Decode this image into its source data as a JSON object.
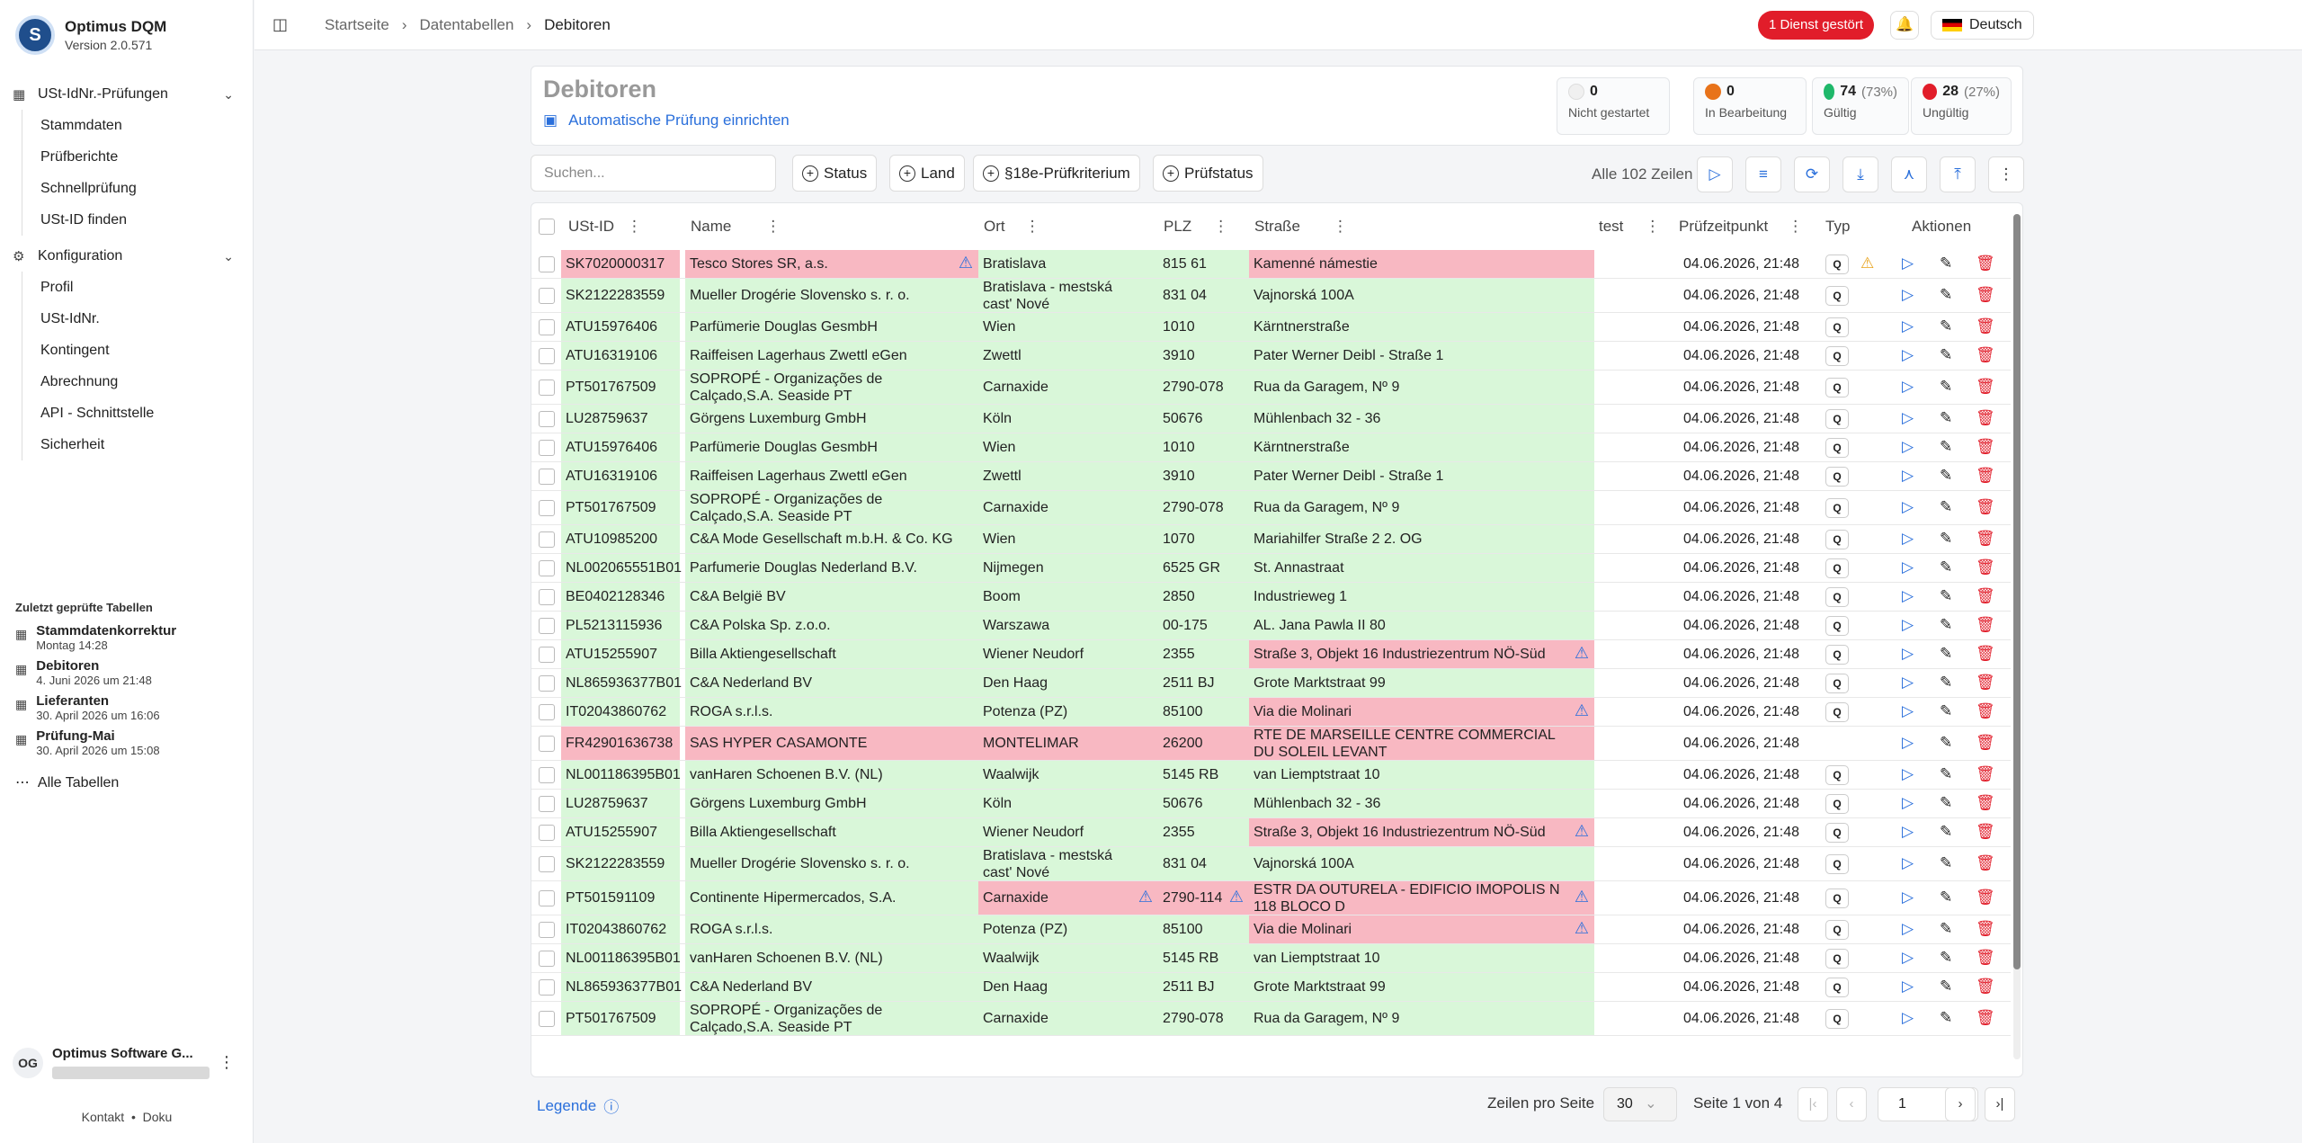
{
  "app": {
    "name": "Optimus DQM",
    "version": "Version 2.0.571",
    "logo_letter": "S"
  },
  "sidebar": {
    "group1": {
      "label": "USt-IdNr.-Prüfungen",
      "items": [
        "Stammdaten",
        "Prüfberichte",
        "Schnellprüfung",
        "USt-ID finden"
      ]
    },
    "group2": {
      "label": "Konfiguration",
      "items": [
        "Profil",
        "USt-IdNr.",
        "Kontingent",
        "Abrechnung",
        "API - Schnittstelle",
        "Sicherheit"
      ]
    },
    "recent_title": "Zuletzt geprüfte Tabellen",
    "recent": [
      {
        "name": "Stammdatenkorrektur",
        "date": "Montag 14:28"
      },
      {
        "name": "Debitoren",
        "date": "4. Juni 2026 um 21:48"
      },
      {
        "name": "Lieferanten",
        "date": "30. April 2026 um 16:06"
      },
      {
        "name": "Prüfung-Mai",
        "date": "30. April 2026 um 15:08"
      }
    ],
    "all_tables": "Alle Tabellen",
    "user": {
      "initials": "OG",
      "name": "Optimus Software G..."
    },
    "footer": {
      "contact": "Kontakt",
      "sep": "•",
      "docs": "Doku"
    }
  },
  "topbar": {
    "breadcrumb": [
      "Startseite",
      "Datentabellen",
      "Debitoren"
    ],
    "service_alert": "1 Dienst gestört",
    "language": "Deutsch"
  },
  "header": {
    "title": "Debitoren",
    "auto_check": "Automatische Prüfung einrichten",
    "stats": [
      {
        "value": "0",
        "pct": "",
        "label": "Nicht gestartet",
        "color": "#f0f0f0"
      },
      {
        "value": "0",
        "pct": "",
        "label": "In Bearbeitung",
        "color": "#e8731a"
      },
      {
        "value": "74",
        "pct": "(73%)",
        "label": "Gültig",
        "color": "#1fb86a"
      },
      {
        "value": "28",
        "pct": "(27%)",
        "label": "Ungültig",
        "color": "#e11d2a"
      }
    ]
  },
  "toolbar": {
    "search_placeholder": "Suchen...",
    "filters": [
      "Status",
      "Land",
      "§18e-Prüfkriterium",
      "Prüfstatus"
    ],
    "all_rows": "Alle 102 Zeilen"
  },
  "table": {
    "columns": [
      "USt-ID",
      "Name",
      "Ort",
      "PLZ",
      "Straße",
      "test",
      "Prüfzeitpunkt",
      "Typ",
      "Aktionen"
    ],
    "rows": [
      {
        "id": "SK7020000317",
        "name": "Tesco Stores SR, a.s.",
        "ort": "Bratislava",
        "plz": "815 61",
        "str": "Kamenné námestie",
        "time": "04.06.2026, 21:48",
        "q": "Q",
        "s": [
          "r",
          "r",
          "g",
          "g",
          "r"
        ],
        "w": [
          "name"
        ],
        "tw": true
      },
      {
        "id": "SK2122283559",
        "name": "Mueller Drogérie Slovensko s. r. o.",
        "ort": "Bratislava - mestská cast' Nové",
        "plz": "831 04",
        "str": "Vajnorská 100A",
        "time": "04.06.2026, 21:48",
        "q": "Q",
        "s": [
          "g",
          "g",
          "g",
          "g",
          "g"
        ],
        "w": []
      },
      {
        "id": "ATU15976406",
        "name": "Parfümerie Douglas GesmbH",
        "ort": "Wien",
        "plz": "1010",
        "str": "Kärntnerstraße",
        "time": "04.06.2026, 21:48",
        "q": "Q",
        "s": [
          "g",
          "g",
          "g",
          "g",
          "g"
        ],
        "w": []
      },
      {
        "id": "ATU16319106",
        "name": "Raiffeisen Lagerhaus Zwettl eGen",
        "ort": "Zwettl",
        "plz": "3910",
        "str": "Pater Werner Deibl - Straße 1",
        "time": "04.06.2026, 21:48",
        "q": "Q",
        "s": [
          "g",
          "g",
          "g",
          "g",
          "g"
        ],
        "w": []
      },
      {
        "id": "PT501767509",
        "name": "SOPROPÉ - Organizações de Calçado,S.A. Seaside PT",
        "ort": "Carnaxide",
        "plz": "2790-078",
        "str": "Rua da Garagem, Nº 9",
        "time": "04.06.2026, 21:48",
        "q": "Q",
        "s": [
          "g",
          "g",
          "g",
          "g",
          "g"
        ],
        "w": []
      },
      {
        "id": "LU28759637",
        "name": "Görgens Luxemburg GmbH",
        "ort": "Köln",
        "plz": "50676",
        "str": "Mühlenbach 32 - 36",
        "time": "04.06.2026, 21:48",
        "q": "Q",
        "s": [
          "g",
          "g",
          "g",
          "g",
          "g"
        ],
        "w": []
      },
      {
        "id": "ATU15976406",
        "name": "Parfümerie Douglas GesmbH",
        "ort": "Wien",
        "plz": "1010",
        "str": "Kärntnerstraße",
        "time": "04.06.2026, 21:48",
        "q": "Q",
        "s": [
          "g",
          "g",
          "g",
          "g",
          "g"
        ],
        "w": []
      },
      {
        "id": "ATU16319106",
        "name": "Raiffeisen Lagerhaus Zwettl eGen",
        "ort": "Zwettl",
        "plz": "3910",
        "str": "Pater Werner Deibl - Straße 1",
        "time": "04.06.2026, 21:48",
        "q": "Q",
        "s": [
          "g",
          "g",
          "g",
          "g",
          "g"
        ],
        "w": []
      },
      {
        "id": "PT501767509",
        "name": "SOPROPÉ - Organizações de Calçado,S.A. Seaside PT",
        "ort": "Carnaxide",
        "plz": "2790-078",
        "str": "Rua da Garagem, Nº 9",
        "time": "04.06.2026, 21:48",
        "q": "Q",
        "s": [
          "g",
          "g",
          "g",
          "g",
          "g"
        ],
        "w": []
      },
      {
        "id": "ATU10985200",
        "name": "C&A Mode Gesellschaft m.b.H. & Co. KG",
        "ort": "Wien",
        "plz": "1070",
        "str": "Mariahilfer Straße 2 2. OG",
        "time": "04.06.2026, 21:48",
        "q": "Q",
        "s": [
          "g",
          "g",
          "g",
          "g",
          "g"
        ],
        "w": []
      },
      {
        "id": "NL002065551B01",
        "name": "Parfumerie Douglas Nederland B.V.",
        "ort": "Nijmegen",
        "plz": "6525 GR",
        "str": "St. Annastraat",
        "time": "04.06.2026, 21:48",
        "q": "Q",
        "s": [
          "g",
          "g",
          "g",
          "g",
          "g"
        ],
        "w": []
      },
      {
        "id": "BE0402128346",
        "name": "C&A België BV",
        "ort": "Boom",
        "plz": "2850",
        "str": "Industrieweg 1",
        "time": "04.06.2026, 21:48",
        "q": "Q",
        "s": [
          "g",
          "g",
          "g",
          "g",
          "g"
        ],
        "w": []
      },
      {
        "id": "PL5213115936",
        "name": "C&A Polska Sp. z.o.o.",
        "ort": "Warszawa",
        "plz": "00-175",
        "str": "AL. Jana Pawla II 80",
        "time": "04.06.2026, 21:48",
        "q": "Q",
        "s": [
          "g",
          "g",
          "g",
          "g",
          "g"
        ],
        "w": []
      },
      {
        "id": "ATU15255907",
        "name": "Billa Aktiengesellschaft",
        "ort": "Wiener Neudorf",
        "plz": "2355",
        "str": "Straße 3, Objekt 16 Industriezentrum NÖ-Süd",
        "time": "04.06.2026, 21:48",
        "q": "Q",
        "s": [
          "g",
          "g",
          "g",
          "g",
          "r"
        ],
        "w": [
          "str"
        ]
      },
      {
        "id": "NL865936377B01",
        "name": "C&A Nederland BV",
        "ort": "Den Haag",
        "plz": "2511 BJ",
        "str": "Grote Marktstraat 99",
        "time": "04.06.2026, 21:48",
        "q": "Q",
        "s": [
          "g",
          "g",
          "g",
          "g",
          "g"
        ],
        "w": []
      },
      {
        "id": "IT02043860762",
        "name": "ROGA s.r.l.s.",
        "ort": "Potenza (PZ)",
        "plz": "85100",
        "str": "Via die Molinari",
        "time": "04.06.2026, 21:48",
        "q": "Q",
        "s": [
          "g",
          "g",
          "g",
          "g",
          "r"
        ],
        "w": [
          "str"
        ]
      },
      {
        "id": "FR42901636738",
        "name": "SAS HYPER CASAMONTE",
        "ort": "MONTELIMAR",
        "plz": "26200",
        "str": "RTE DE MARSEILLE CENTRE COMMERCIAL DU SOLEIL LEVANT",
        "time": "04.06.2026, 21:48",
        "q": "",
        "s": [
          "r",
          "r",
          "r",
          "r",
          "r"
        ],
        "w": []
      },
      {
        "id": "NL001186395B01",
        "name": "vanHaren Schoenen B.V. (NL)",
        "ort": "Waalwijk",
        "plz": "5145 RB",
        "str": "van Liemptstraat 10",
        "time": "04.06.2026, 21:48",
        "q": "Q",
        "s": [
          "g",
          "g",
          "g",
          "g",
          "g"
        ],
        "w": []
      },
      {
        "id": "LU28759637",
        "name": "Görgens Luxemburg GmbH",
        "ort": "Köln",
        "plz": "50676",
        "str": "Mühlenbach 32 - 36",
        "time": "04.06.2026, 21:48",
        "q": "Q",
        "s": [
          "g",
          "g",
          "g",
          "g",
          "g"
        ],
        "w": []
      },
      {
        "id": "ATU15255907",
        "name": "Billa Aktiengesellschaft",
        "ort": "Wiener Neudorf",
        "plz": "2355",
        "str": "Straße 3, Objekt 16 Industriezentrum NÖ-Süd",
        "time": "04.06.2026, 21:48",
        "q": "Q",
        "s": [
          "g",
          "g",
          "g",
          "g",
          "r"
        ],
        "w": [
          "str"
        ]
      },
      {
        "id": "SK2122283559",
        "name": "Mueller Drogérie Slovensko s. r. o.",
        "ort": "Bratislava - mestská cast' Nové",
        "plz": "831 04",
        "str": "Vajnorská 100A",
        "time": "04.06.2026, 21:48",
        "q": "Q",
        "s": [
          "g",
          "g",
          "g",
          "g",
          "g"
        ],
        "w": []
      },
      {
        "id": "PT501591109",
        "name": "Continente Hipermercados, S.A.",
        "ort": "Carnaxide",
        "plz": "2790-114",
        "str": "ESTR DA OUTURELA - EDIFICIO IMOPOLIS N 118 BLOCO D",
        "time": "04.06.2026, 21:48",
        "q": "Q",
        "s": [
          "g",
          "g",
          "r",
          "r",
          "r"
        ],
        "w": [
          "ort",
          "plz",
          "str"
        ]
      },
      {
        "id": "IT02043860762",
        "name": "ROGA s.r.l.s.",
        "ort": "Potenza (PZ)",
        "plz": "85100",
        "str": "Via die Molinari",
        "time": "04.06.2026, 21:48",
        "q": "Q",
        "s": [
          "g",
          "g",
          "g",
          "g",
          "r"
        ],
        "w": [
          "str"
        ]
      },
      {
        "id": "NL001186395B01",
        "name": "vanHaren Schoenen B.V. (NL)",
        "ort": "Waalwijk",
        "plz": "5145 RB",
        "str": "van Liemptstraat 10",
        "time": "04.06.2026, 21:48",
        "q": "Q",
        "s": [
          "g",
          "g",
          "g",
          "g",
          "g"
        ],
        "w": []
      },
      {
        "id": "NL865936377B01",
        "name": "C&A Nederland BV",
        "ort": "Den Haag",
        "plz": "2511 BJ",
        "str": "Grote Marktstraat 99",
        "time": "04.06.2026, 21:48",
        "q": "Q",
        "s": [
          "g",
          "g",
          "g",
          "g",
          "g"
        ],
        "w": []
      },
      {
        "id": "PT501767509",
        "name": "SOPROPÉ - Organizações de Calçado,S.A. Seaside PT",
        "ort": "Carnaxide",
        "plz": "2790-078",
        "str": "Rua da Garagem, Nº 9",
        "time": "04.06.2026, 21:48",
        "q": "Q",
        "s": [
          "g",
          "g",
          "g",
          "g",
          "g"
        ],
        "w": []
      }
    ]
  },
  "footer": {
    "legend": "Legende",
    "rows_per_page_label": "Zeilen pro Seite",
    "rows_per_page": "30",
    "page_info": "Seite 1 von 4",
    "page_input": "1"
  }
}
